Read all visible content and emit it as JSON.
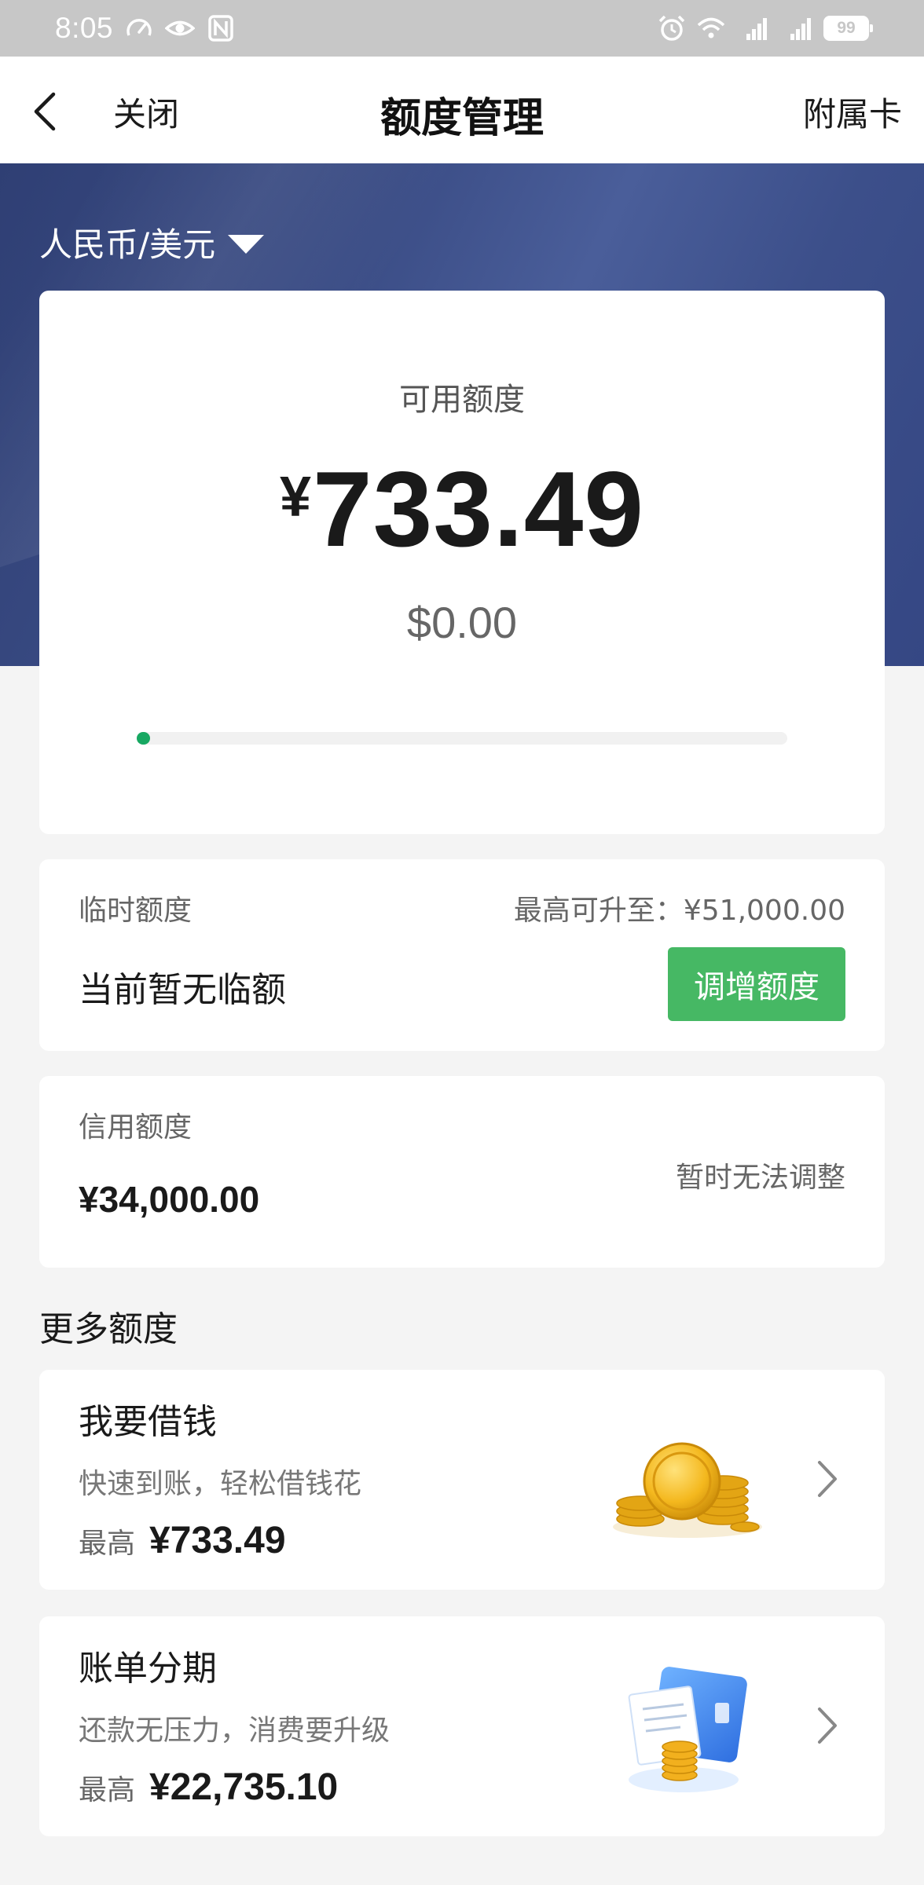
{
  "status_bar": {
    "time": "8:05",
    "battery": "99"
  },
  "nav": {
    "close_label": "关闭",
    "title": "额度管理",
    "right_label": "附属卡"
  },
  "currency_select": {
    "value": "人民币/美元"
  },
  "available": {
    "label": "可用额度",
    "currency_symbol": "¥",
    "amount": "733.49",
    "usd_amount": "$0.00",
    "usage_fraction": 0.02,
    "progress_color": "#17a862"
  },
  "temporary": {
    "label": "临时额度",
    "max_label": "最高可升至：¥51,000.00",
    "status": "当前暂无临额",
    "button_label": "调增额度"
  },
  "credit": {
    "label": "信用额度",
    "amount": "¥34,000.00",
    "note": "暂时无法调整"
  },
  "more": {
    "section_title": "更多额度",
    "items": [
      {
        "title": "我要借钱",
        "subtitle": "快速到账，轻松借钱花",
        "prefix": "最高",
        "amount": "¥733.49",
        "icon": "gold-coins-icon"
      },
      {
        "title": "账单分期",
        "subtitle": "还款无压力，消费要升级",
        "prefix": "最高",
        "amount": "¥22,735.10",
        "icon": "card-bill-coins-icon"
      }
    ]
  },
  "colors": {
    "hero": "#3b4d86",
    "accent_green": "#46b864",
    "status_bar": "#c7c7c7"
  }
}
